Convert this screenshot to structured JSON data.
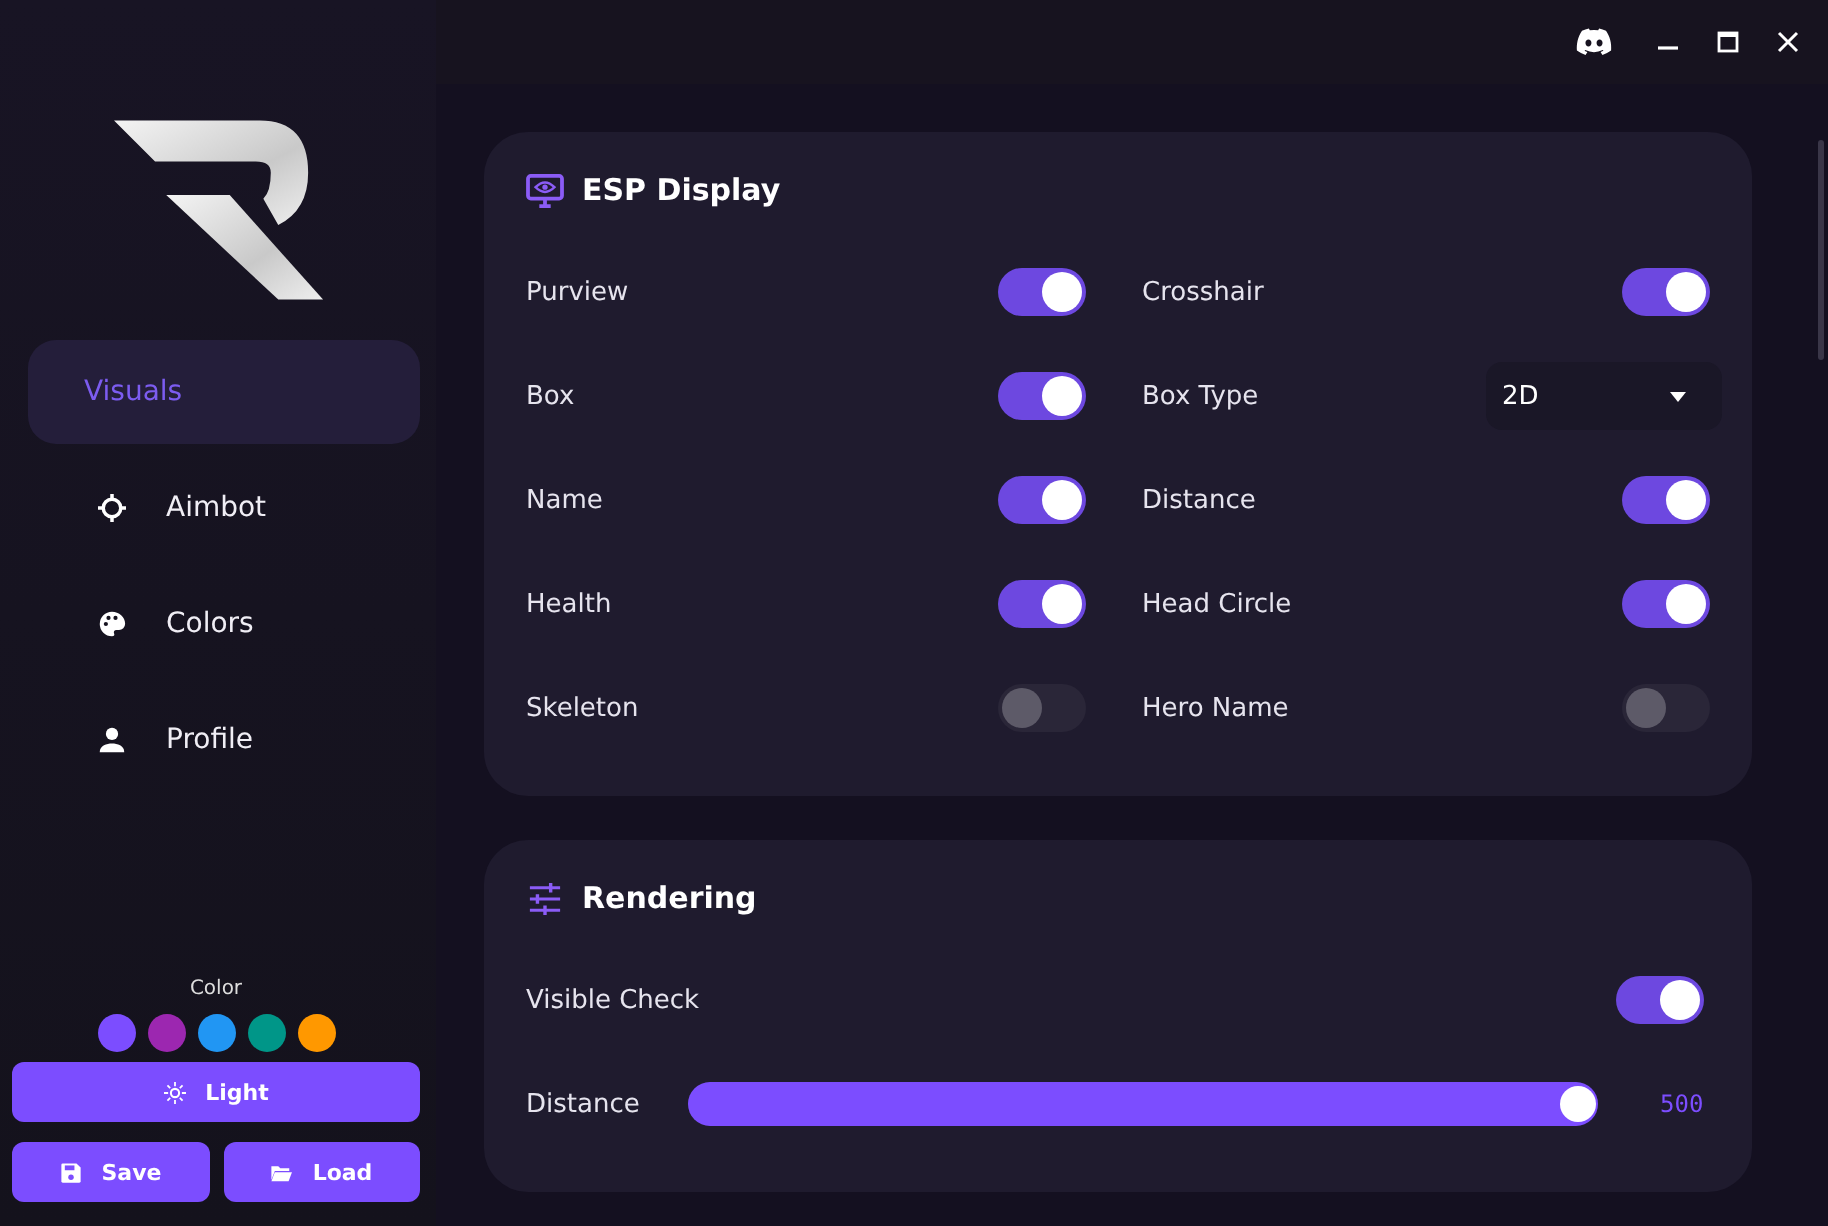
{
  "sidebar": {
    "items": [
      {
        "label": "Visuals",
        "selected": true
      },
      {
        "label": "Aimbot",
        "selected": false
      },
      {
        "label": "Colors",
        "selected": false
      },
      {
        "label": "Profile",
        "selected": false
      }
    ],
    "color_label": "Color",
    "swatches": [
      {
        "color": "#7c4dff"
      },
      {
        "color": "#9c27b0"
      },
      {
        "color": "#2196f3"
      },
      {
        "color": "#009688"
      },
      {
        "color": "#ff9800"
      }
    ],
    "theme_button": "Light",
    "save_button": "Save",
    "load_button": "Load"
  },
  "cards": [
    {
      "title": "ESP Display",
      "rows": [
        [
          {
            "kind": "toggle",
            "label": "Purview",
            "on": true
          },
          {
            "kind": "toggle",
            "label": "Crosshair",
            "on": true
          }
        ],
        [
          {
            "kind": "toggle",
            "label": "Box",
            "on": true
          },
          {
            "kind": "select",
            "label": "Box Type",
            "value": "2D"
          }
        ],
        [
          {
            "kind": "toggle",
            "label": "Name",
            "on": true
          },
          {
            "kind": "toggle",
            "label": "Distance",
            "on": true
          }
        ],
        [
          {
            "kind": "toggle",
            "label": "Health",
            "on": true
          },
          {
            "kind": "toggle",
            "label": "Head Circle",
            "on": true
          }
        ],
        [
          {
            "kind": "toggle",
            "label": "Skeleton",
            "on": false
          },
          {
            "kind": "toggle",
            "label": "Hero Name",
            "on": false
          }
        ]
      ]
    },
    {
      "title": "Rendering",
      "rows": [
        [
          {
            "kind": "toggle",
            "label": "Visible Check",
            "on": true
          }
        ],
        [
          {
            "kind": "slider",
            "label": "Distance",
            "level": 1.0,
            "reading": "500"
          }
        ]
      ]
    }
  ]
}
